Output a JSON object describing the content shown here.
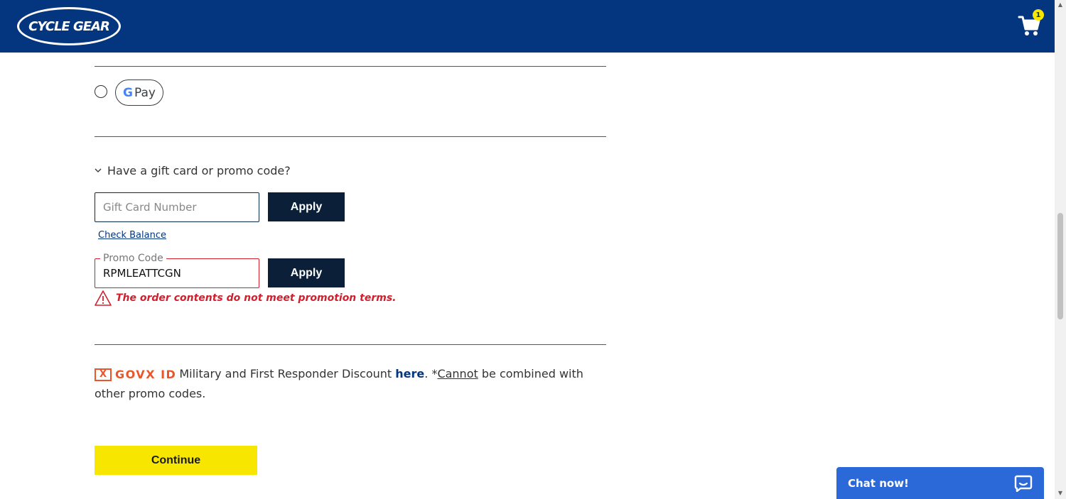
{
  "header": {
    "logo_text": "CYCLE GEAR",
    "cart_count": "1",
    "cart_icon": "shopping-cart-icon"
  },
  "payment": {
    "gpay_g": "G",
    "gpay_label": "Pay"
  },
  "promo": {
    "toggle_label": "Have a gift card or promo code?",
    "gift_placeholder": "Gift Card Number",
    "apply_label": "Apply",
    "check_balance": "Check Balance",
    "promo_label": "Promo Code",
    "promo_value": "RPMLEATTCGN",
    "error_message": "The order contents do not meet promotion terms."
  },
  "govx": {
    "logo_x": "X",
    "logo_text": "GOVX ID",
    "text_before": "Military and First Responder Discount ",
    "link_text": "here",
    "text_mid": ". *",
    "cannot": "Cannot",
    "text_after": " be combined with other promo codes."
  },
  "actions": {
    "continue_label": "Continue"
  },
  "chat": {
    "label": "Chat now!"
  },
  "colors": {
    "header_bg": "#04367f",
    "button_dark": "#0b2038",
    "continue_yellow": "#f7e600",
    "error_red": "#d0202e",
    "chat_blue": "#2b68d8",
    "govx_orange": "#e8562a"
  }
}
